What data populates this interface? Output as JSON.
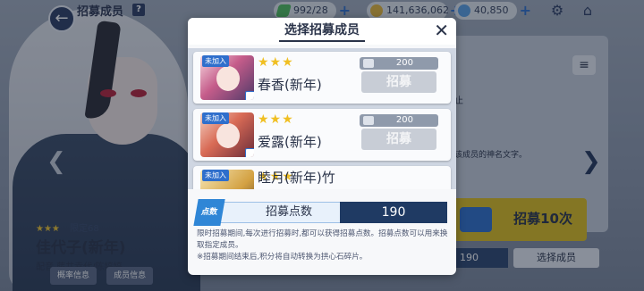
{
  "topbar": {
    "back_icon": "back-arrow-icon",
    "title": "招募成员",
    "help_label": "?",
    "ap": "992/28",
    "credits": "141,636,062",
    "gems": "40,850",
    "plus": "+"
  },
  "background": {
    "rarity": "★★★",
    "level": "限定68",
    "character_name": "佳代子(新年)",
    "voice_credit": "配音 藤井幸代/陈婷婷",
    "tab_rates": "概率信息",
    "tab_members": "成员信息",
    "header_fragment": "止",
    "info_fragment": "该成员的神名文字。",
    "recruit_ten_label": "招募10次",
    "mail_badge": "10",
    "points_value": "190",
    "select_member_label": "选择成员",
    "menu_label": "≡",
    "arrow_next": "❯",
    "arrow_prev": "❮"
  },
  "modal": {
    "title": "选择招募成员",
    "close_label": "✕",
    "cards": [
      {
        "status": "未加入",
        "stars": "★★★",
        "name": "春香(新年)",
        "cost": "200",
        "button_label": "招募"
      },
      {
        "status": "未加入",
        "stars": "★★★",
        "name": "爱露(新年)",
        "cost": "200",
        "button_label": "招募"
      },
      {
        "status": "未加入",
        "stars": "★★★",
        "name": "睦月(新年)竹",
        "cost": "",
        "button_label": ""
      }
    ],
    "points_badge": "点数",
    "points_label": "招募点数",
    "points_value": "190",
    "note_line1": "限时招募期间,每次进行招募时,都可以获得招募点数。招募点数可以用来换取指定成员。",
    "note_line2": "※招募期间结束后,积分将自动转换为拱心石碎片。"
  },
  "colors": {
    "accent_blue": "#2f6fcc",
    "dark_navy": "#1f3a63",
    "star_gold": "#f0bf22"
  }
}
